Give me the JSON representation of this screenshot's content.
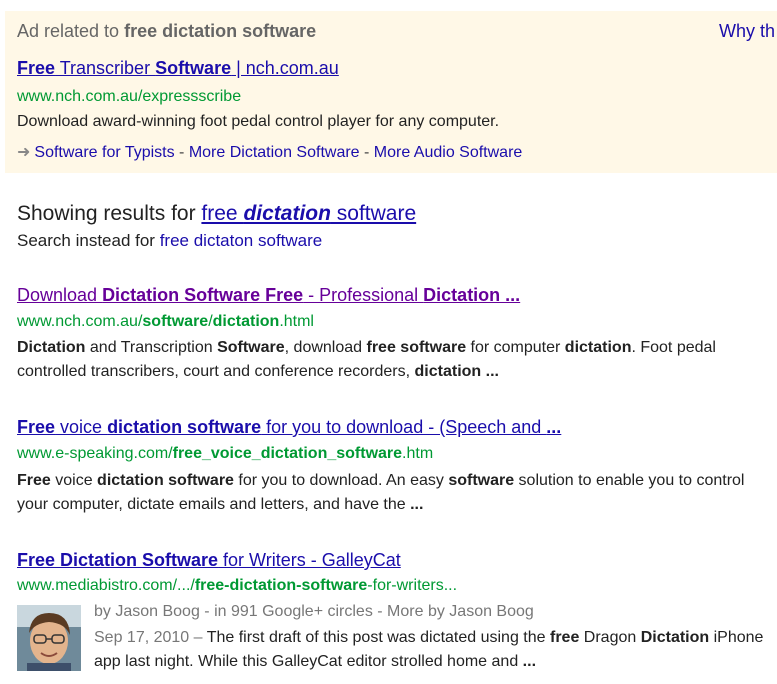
{
  "ad": {
    "heading_prefix": "Ad related to ",
    "heading_query": "free dictation software",
    "why_link": "Why th",
    "title_parts": [
      {
        "text": "Free",
        "bold": true
      },
      {
        "text": " Transcriber ",
        "bold": false
      },
      {
        "text": "Software",
        "bold": true
      },
      {
        "text": " | nch.com.au",
        "bold": false
      }
    ],
    "url": "www.nch.com.au/expressscribe",
    "description": "Download award-winning foot pedal control player for any computer.",
    "sitelinks": [
      "Software for Typists",
      "More Dictation Software",
      "More Audio Software"
    ],
    "sitelink_separator": " - "
  },
  "spelling": {
    "showing_prefix": "Showing results for ",
    "corrected_parts": [
      {
        "text": "free ",
        "bold": false
      },
      {
        "text": "dictation",
        "bold": true
      },
      {
        "text": " software",
        "bold": false
      }
    ],
    "instead_prefix": "Search instead for ",
    "instead_query": "free dictaton software"
  },
  "results": [
    {
      "visited": true,
      "title_parts": [
        {
          "text": "Download ",
          "bold": false
        },
        {
          "text": "Dictation Software Free",
          "bold": true
        },
        {
          "text": " - Professional ",
          "bold": false
        },
        {
          "text": "Dictation ...",
          "bold": true
        }
      ],
      "url_parts": [
        {
          "text": "www.nch.com.au/",
          "bold": false
        },
        {
          "text": "software",
          "bold": true
        },
        {
          "text": "/",
          "bold": false
        },
        {
          "text": "dictation",
          "bold": true
        },
        {
          "text": ".html",
          "bold": false
        }
      ],
      "snippet_parts": [
        {
          "text": "Dictation",
          "bold": true
        },
        {
          "text": " and Transcription ",
          "bold": false
        },
        {
          "text": "Software",
          "bold": true
        },
        {
          "text": ", download ",
          "bold": false
        },
        {
          "text": "free software",
          "bold": true
        },
        {
          "text": " for computer ",
          "bold": false
        },
        {
          "text": "dictation",
          "bold": true
        },
        {
          "text": ". Foot pedal controlled transcribers, court and conference recorders, ",
          "bold": false
        },
        {
          "text": "dictation ...",
          "bold": true
        }
      ]
    },
    {
      "visited": false,
      "title_parts": [
        {
          "text": "Free",
          "bold": true
        },
        {
          "text": " voice ",
          "bold": false
        },
        {
          "text": "dictation software",
          "bold": true
        },
        {
          "text": " for you to download - (Speech and ",
          "bold": false
        },
        {
          "text": "...",
          "bold": true
        }
      ],
      "url_parts": [
        {
          "text": "www.e-speaking.com/",
          "bold": false
        },
        {
          "text": "free_voice_dictation_software",
          "bold": true
        },
        {
          "text": ".htm",
          "bold": false
        }
      ],
      "snippet_parts": [
        {
          "text": "Free",
          "bold": true
        },
        {
          "text": " voice ",
          "bold": false
        },
        {
          "text": "dictation software",
          "bold": true
        },
        {
          "text": " for you to download. An easy ",
          "bold": false
        },
        {
          "text": "software",
          "bold": true
        },
        {
          "text": " solution to enable you to control your computer, dictate emails and letters, and have the ",
          "bold": false
        },
        {
          "text": "...",
          "bold": true
        }
      ]
    },
    {
      "visited": false,
      "title_parts": [
        {
          "text": "Free Dictation Software",
          "bold": true
        },
        {
          "text": " for Writers - GalleyCat",
          "bold": false
        }
      ],
      "url_parts": [
        {
          "text": "www.mediabistro.com/.../",
          "bold": false
        },
        {
          "text": "free-dictation-software",
          "bold": true
        },
        {
          "text": "-for-writers...",
          "bold": false
        }
      ],
      "author_line": "by Jason Boog - in 991 Google+ circles - More by Jason Boog",
      "date": "Sep 17, 2010",
      "date_separator": " – ",
      "snippet_parts": [
        {
          "text": "The first draft of this post was dictated using the ",
          "bold": false
        },
        {
          "text": "free",
          "bold": true
        },
        {
          "text": " Dragon ",
          "bold": false
        },
        {
          "text": "Dictation",
          "bold": true
        },
        {
          "text": " iPhone app last night. While this GalleyCat editor strolled home and ",
          "bold": false
        },
        {
          "text": "...",
          "bold": true
        }
      ]
    }
  ],
  "colors": {
    "link": "#1a0dab",
    "visited": "#660099",
    "url_green": "#009933",
    "ad_background": "#fff8e7",
    "muted": "#777777"
  },
  "icons": {
    "sitelink_arrow": "arrow-right-icon"
  }
}
